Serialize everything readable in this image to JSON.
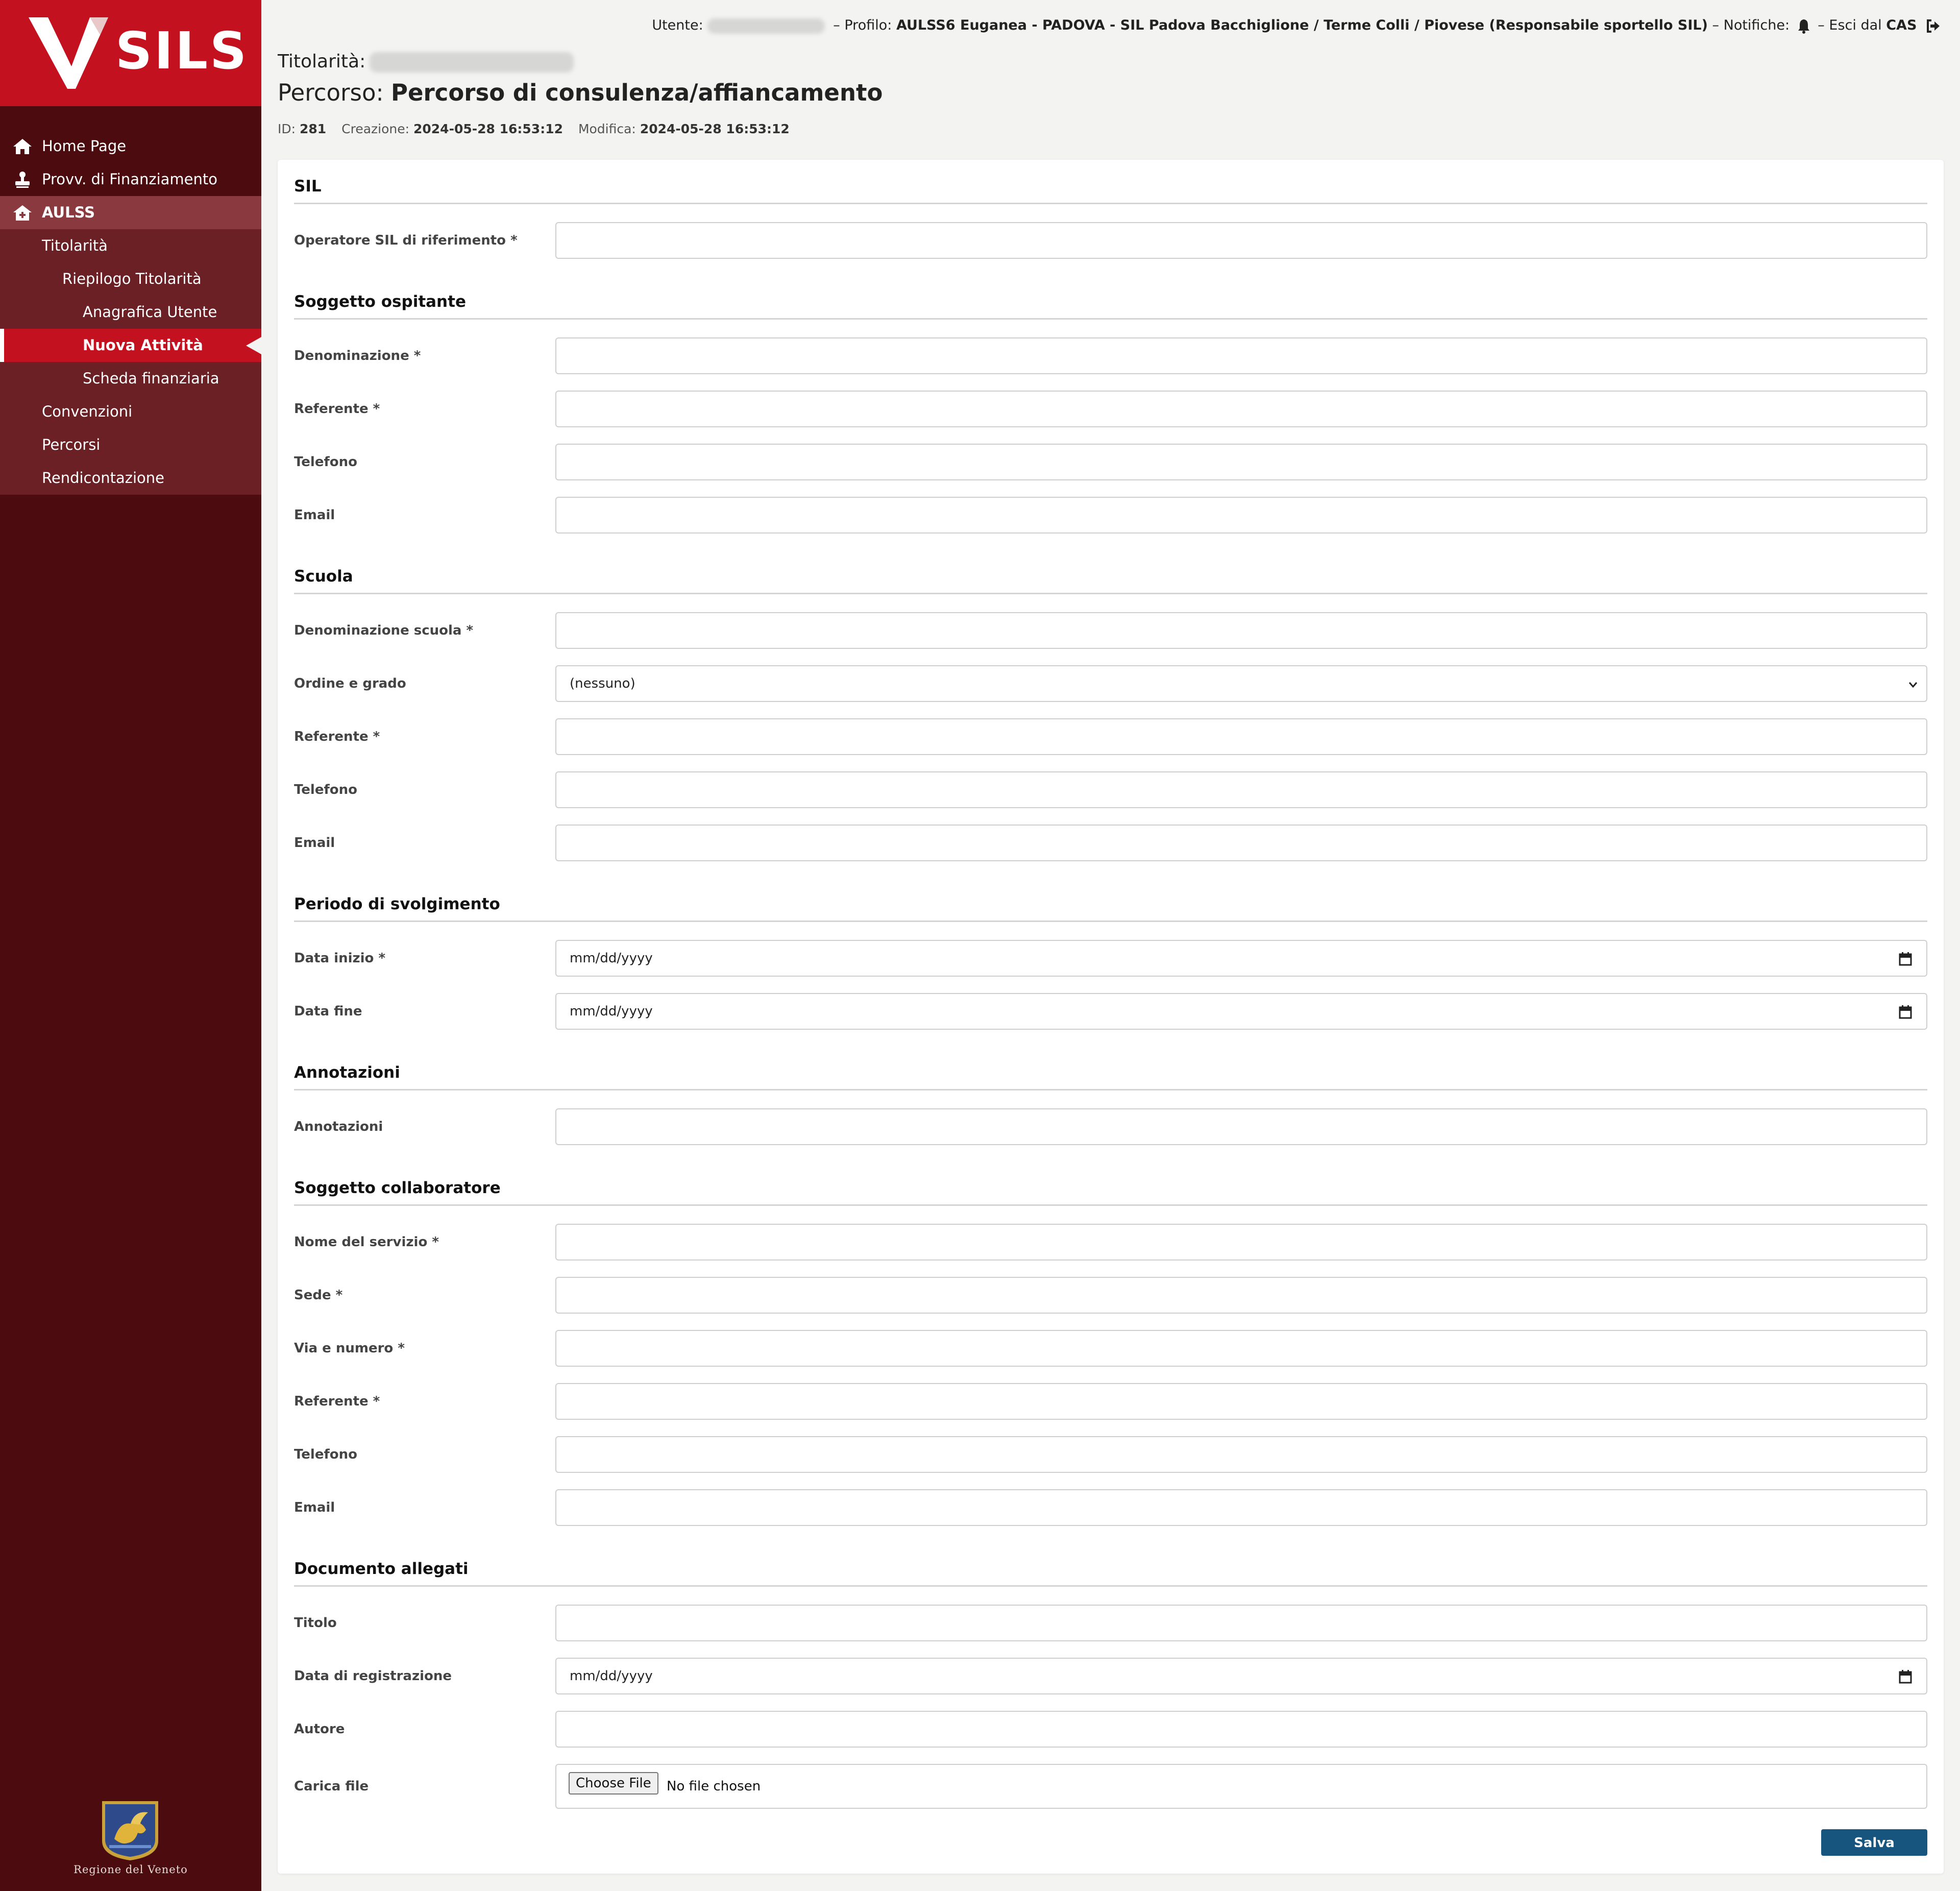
{
  "brand": {
    "logo_text": "SILS",
    "region_caption": "Regione del Veneto"
  },
  "nav": {
    "home": "Home Page",
    "finanziamento": "Provv. di Finanziamento",
    "aulss": "AULSS",
    "titolarita": "Titolarità",
    "riepilogo": "Riepilogo Titolarità",
    "anagrafica": "Anagrafica Utente",
    "nuova_attivita": "Nuova Attività",
    "scheda": "Scheda finanziaria",
    "convenzioni": "Convenzioni",
    "percorsi": "Percorsi",
    "rendicontazione": "Rendicontazione"
  },
  "topbar": {
    "utente_label": "Utente:",
    "sep": "–",
    "profilo_label": "Profilo:",
    "profilo_value": "AULSS6 Euganea - PADOVA - SIL Padova Bacchiglione / Terme Colli / Piovese (Responsabile sportello SIL)",
    "notifiche_label": "Notifiche:",
    "esci_label": "Esci dal",
    "esci_value": "CAS"
  },
  "header": {
    "titolarita_label": "Titolarità:",
    "percorso_label": "Percorso:",
    "percorso_value": "Percorso di consulenza/affiancamento",
    "id_label": "ID:",
    "id_value": "281",
    "creazione_label": "Creazione:",
    "creazione_value": "2024-05-28 16:53:12",
    "modifica_label": "Modifica:",
    "modifica_value": "2024-05-28 16:53:12"
  },
  "form": {
    "sil": {
      "title": "SIL",
      "operatore": "Operatore SIL di riferimento *"
    },
    "ospitante": {
      "title": "Soggetto ospitante",
      "denominazione": "Denominazione *",
      "referente": "Referente *",
      "telefono": "Telefono",
      "email": "Email"
    },
    "scuola": {
      "title": "Scuola",
      "denominazione": "Denominazione scuola *",
      "ordine": "Ordine e grado",
      "ordine_value": "(nessuno)",
      "referente": "Referente *",
      "telefono": "Telefono",
      "email": "Email"
    },
    "periodo": {
      "title": "Periodo di svolgimento",
      "inizio": "Data inizio *",
      "fine": "Data fine",
      "date_placeholder": "mm/dd/yyyy"
    },
    "annotazioni": {
      "title": "Annotazioni",
      "label": "Annotazioni"
    },
    "collaboratore": {
      "title": "Soggetto collaboratore",
      "servizio": "Nome del servizio *",
      "sede": "Sede *",
      "via": "Via e numero *",
      "referente": "Referente *",
      "telefono": "Telefono",
      "email": "Email"
    },
    "documento": {
      "title": "Documento allegati",
      "titolo": "Titolo",
      "data": "Data di registrazione",
      "autore": "Autore",
      "carica": "Carica file",
      "choose": "Choose File",
      "no_file": "No file chosen"
    },
    "save": "Salva"
  },
  "colors": {
    "brand_red": "#c4111f",
    "sidebar_dark": "#4c0c0f",
    "save_blue": "#17557e"
  }
}
